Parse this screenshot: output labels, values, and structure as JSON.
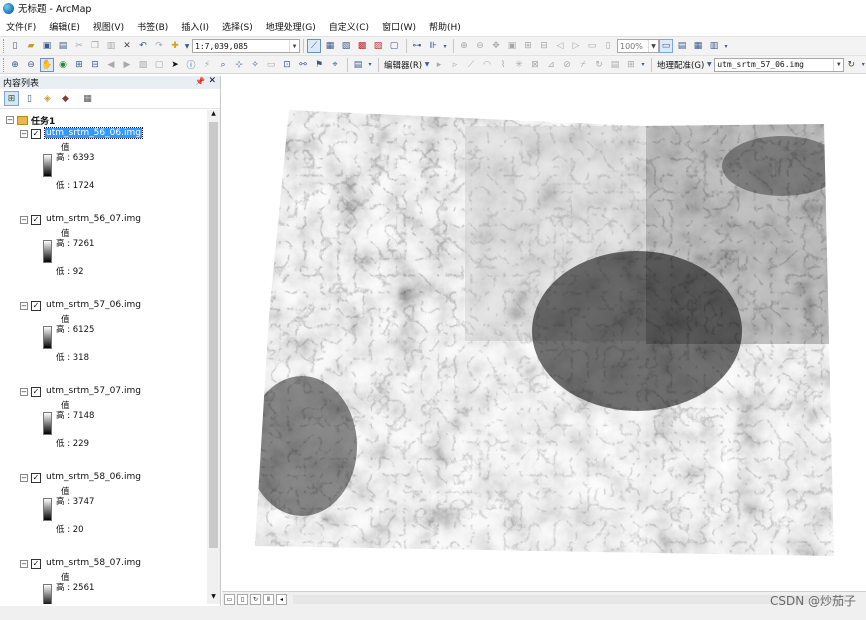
{
  "window": {
    "title": "无标题 - ArcMap"
  },
  "menu": [
    "文件(F)",
    "编辑(E)",
    "视图(V)",
    "书签(B)",
    "插入(I)",
    "选择(S)",
    "地理处理(G)",
    "自定义(C)",
    "窗口(W)",
    "帮助(H)"
  ],
  "toolbar": {
    "scale_value": "1:7,039,085",
    "zoom_percent": "100%",
    "editor_label": "编辑器(R)",
    "georef_label": "地理配准(G)",
    "georef_layer": "utm_srtm_57_06.img"
  },
  "toc": {
    "title": "内容列表",
    "frame_name": "任务1",
    "value_label": "值",
    "layers": [
      {
        "name": "utm_srtm_56_06.img",
        "high": "高 : 6393",
        "low": "低 : 1724"
      },
      {
        "name": "utm_srtm_56_07.img",
        "high": "高 : 7261",
        "low": "低 : 92"
      },
      {
        "name": "utm_srtm_57_06.img",
        "high": "高 : 6125",
        "low": "低 : 318"
      },
      {
        "name": "utm_srtm_57_07.img",
        "high": "高 : 7148",
        "low": "低 : 229"
      },
      {
        "name": "utm_srtm_58_06.img",
        "high": "高 : 3747",
        "low": "低 : 20"
      },
      {
        "name": "utm_srtm_58_07.img",
        "high": "高 : 2561",
        "low": ""
      }
    ]
  },
  "watermark": "CSDN @炒茄子"
}
